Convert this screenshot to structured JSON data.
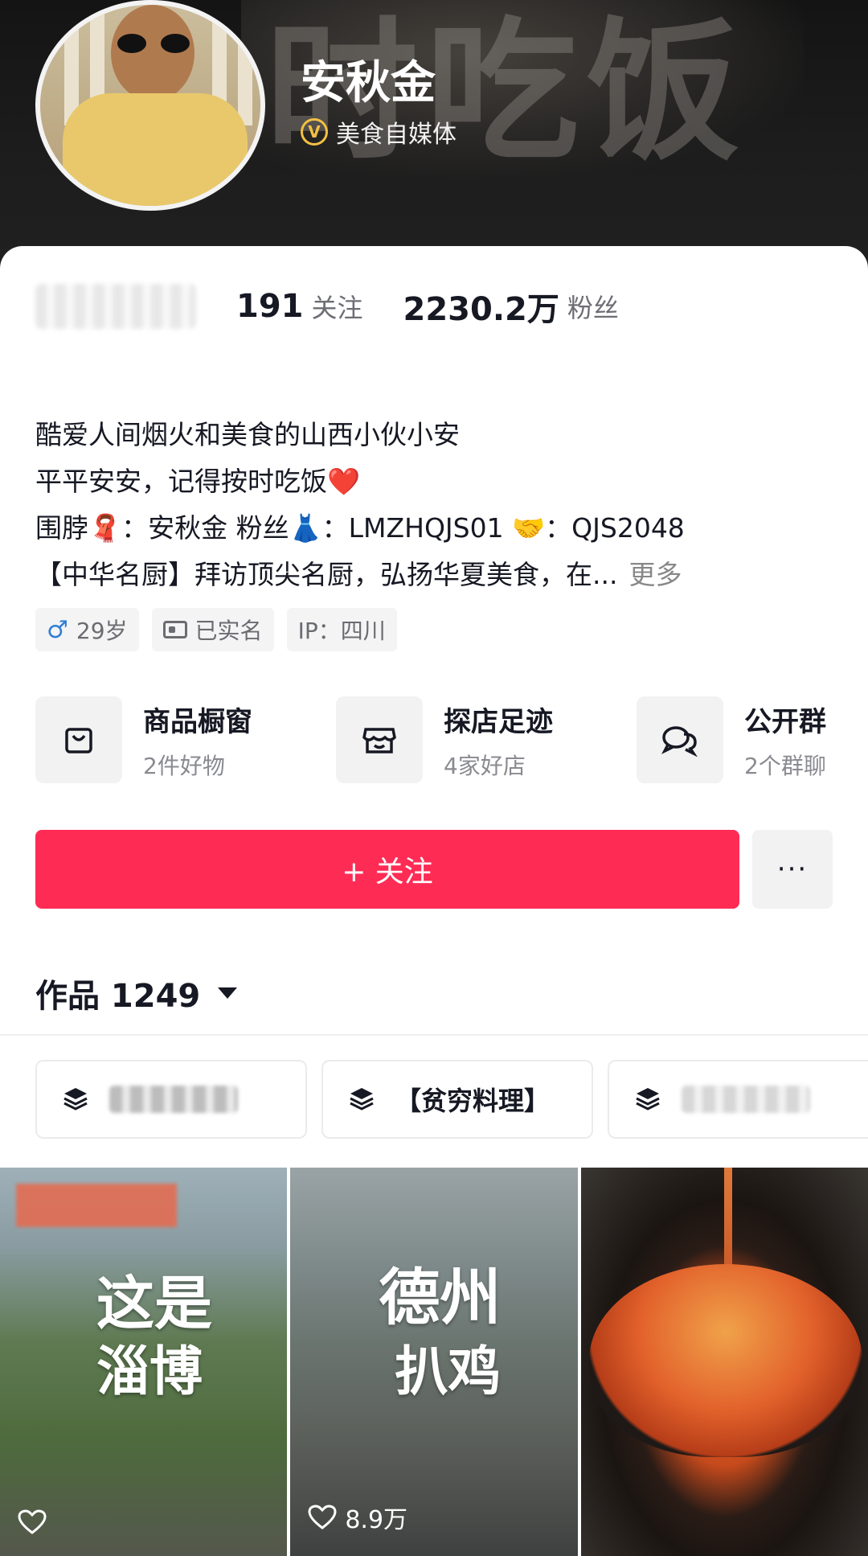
{
  "header": {
    "banner_text": "时吃饭",
    "name": "安秋金",
    "verified_label": "美食自媒体",
    "verified_badge": "V"
  },
  "stats": {
    "following_count": "191",
    "following_label": "关注",
    "followers_count": "2230.2万",
    "followers_label": "粉丝"
  },
  "bio": {
    "line1": "酷爱人间烟火和美食的山西小伙小安",
    "line2": "平平安安，记得按时吃饭❤️",
    "line3": "围脖🧣：安秋金 粉丝👗：LMZHQJS01 🤝：QJS2048",
    "line4": "【中华名厨】拜访顶尖名厨，弘扬华夏美食，在...",
    "more": "更多"
  },
  "tags": {
    "gender_symbol": "♂",
    "age": "29岁",
    "realname": "已实名",
    "ip": "IP：四川"
  },
  "features": [
    {
      "title": "商品橱窗",
      "sub": "2件好物",
      "icon": "shopping-bag-icon"
    },
    {
      "title": "探店足迹",
      "sub": "4家好店",
      "icon": "store-icon"
    },
    {
      "title": "公开群",
      "sub": "2个群聊",
      "icon": "chat-icon"
    }
  ],
  "actions": {
    "follow_label": "+ 关注",
    "more_label": "···"
  },
  "works": {
    "label": "作品 1249"
  },
  "collections": [
    {
      "label": "",
      "blurred": true
    },
    {
      "label": "【贫穷料理】",
      "blurred": false
    },
    {
      "label": "",
      "blurred": true
    }
  ],
  "videos": [
    {
      "title_lines": [
        "这是",
        "淄博"
      ],
      "likes": ""
    },
    {
      "title_lines": [
        "德州",
        "扒鸡"
      ],
      "likes": "8.9万"
    },
    {
      "title_lines": [],
      "likes": ""
    }
  ],
  "colors": {
    "accent": "#fe2c55",
    "badge": "#f3c043",
    "gender": "#2f7fd6"
  }
}
